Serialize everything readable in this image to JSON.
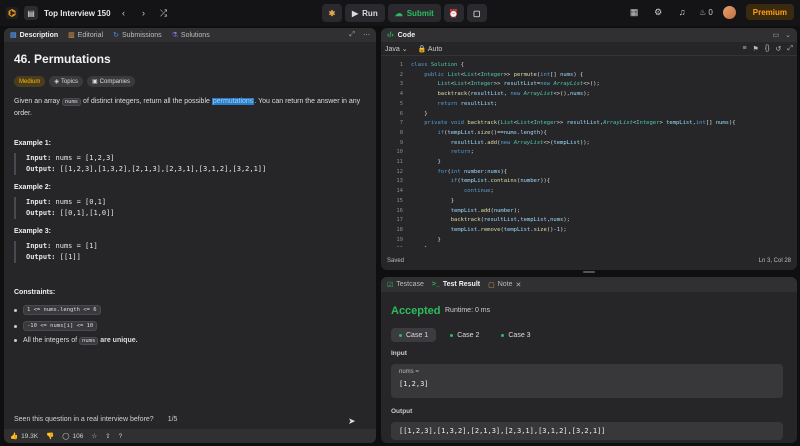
{
  "topbar": {
    "list_title": "Top Interview 150",
    "run_label": "Run",
    "submit_label": "Submit",
    "streak": "0",
    "premium_label": "Premium"
  },
  "left": {
    "tabs": [
      "Description",
      "Editorial",
      "Submissions",
      "Solutions"
    ],
    "title": "46. Permutations",
    "difficulty": "Medium",
    "topics_label": "Topics",
    "companies_label": "Companies",
    "desc_before": "Given an array ",
    "desc_code": "nums",
    "desc_mid": " of distinct integers, return all the possible ",
    "desc_highlight": "permutations",
    "desc_after": ". You can return the answer in any order.",
    "examples": [
      {
        "title": "Example 1:",
        "input": "nums = [1,2,3]",
        "output": "[[1,2,3],[1,3,2],[2,1,3],[2,3,1],[3,1,2],[3,2,1]]"
      },
      {
        "title": "Example 2:",
        "input": "nums = [0,1]",
        "output": "[[0,1],[1,0]]"
      },
      {
        "title": "Example 3:",
        "input": "nums = [1]",
        "output": "[[1]]"
      }
    ],
    "input_label": "Input:",
    "output_label": "Output:",
    "constraints_title": "Constraints:",
    "constraint1": "1 <= nums.length <= 6",
    "constraint2": "-10 <= nums[i] <= 10",
    "c3_before": "All the integers of ",
    "c3_code": "nums",
    "c3_after": " are unique.",
    "seen_text": "Seen this question in a real interview before?",
    "seen_count": "1/5",
    "likes": "19.3K",
    "comments": "106"
  },
  "code": {
    "title": "Code",
    "language": "Java",
    "auto_label": "Auto",
    "line_numbers": [
      "1",
      "2",
      "3",
      "4",
      "5",
      "6",
      "7",
      "8",
      "9",
      "10",
      "11",
      "12",
      "13",
      "14",
      "15",
      "16",
      "17",
      "18",
      "19",
      "20"
    ],
    "saved": "Saved",
    "cursor_pos": "Ln 3, Col 28"
  },
  "test": {
    "tabs": [
      "Testcase",
      "Test Result",
      "Note"
    ],
    "status": "Accepted",
    "runtime": "Runtime: 0 ms",
    "cases": [
      "Case 1",
      "Case 2",
      "Case 3"
    ],
    "input_label": "Input",
    "var_name": "nums =",
    "var_value": "[1,2,3]",
    "output_label": "Output",
    "output_value": "[[1,2,3],[1,3,2],[2,1,3],[2,3,1],[3,1,2],[3,2,1]]"
  }
}
